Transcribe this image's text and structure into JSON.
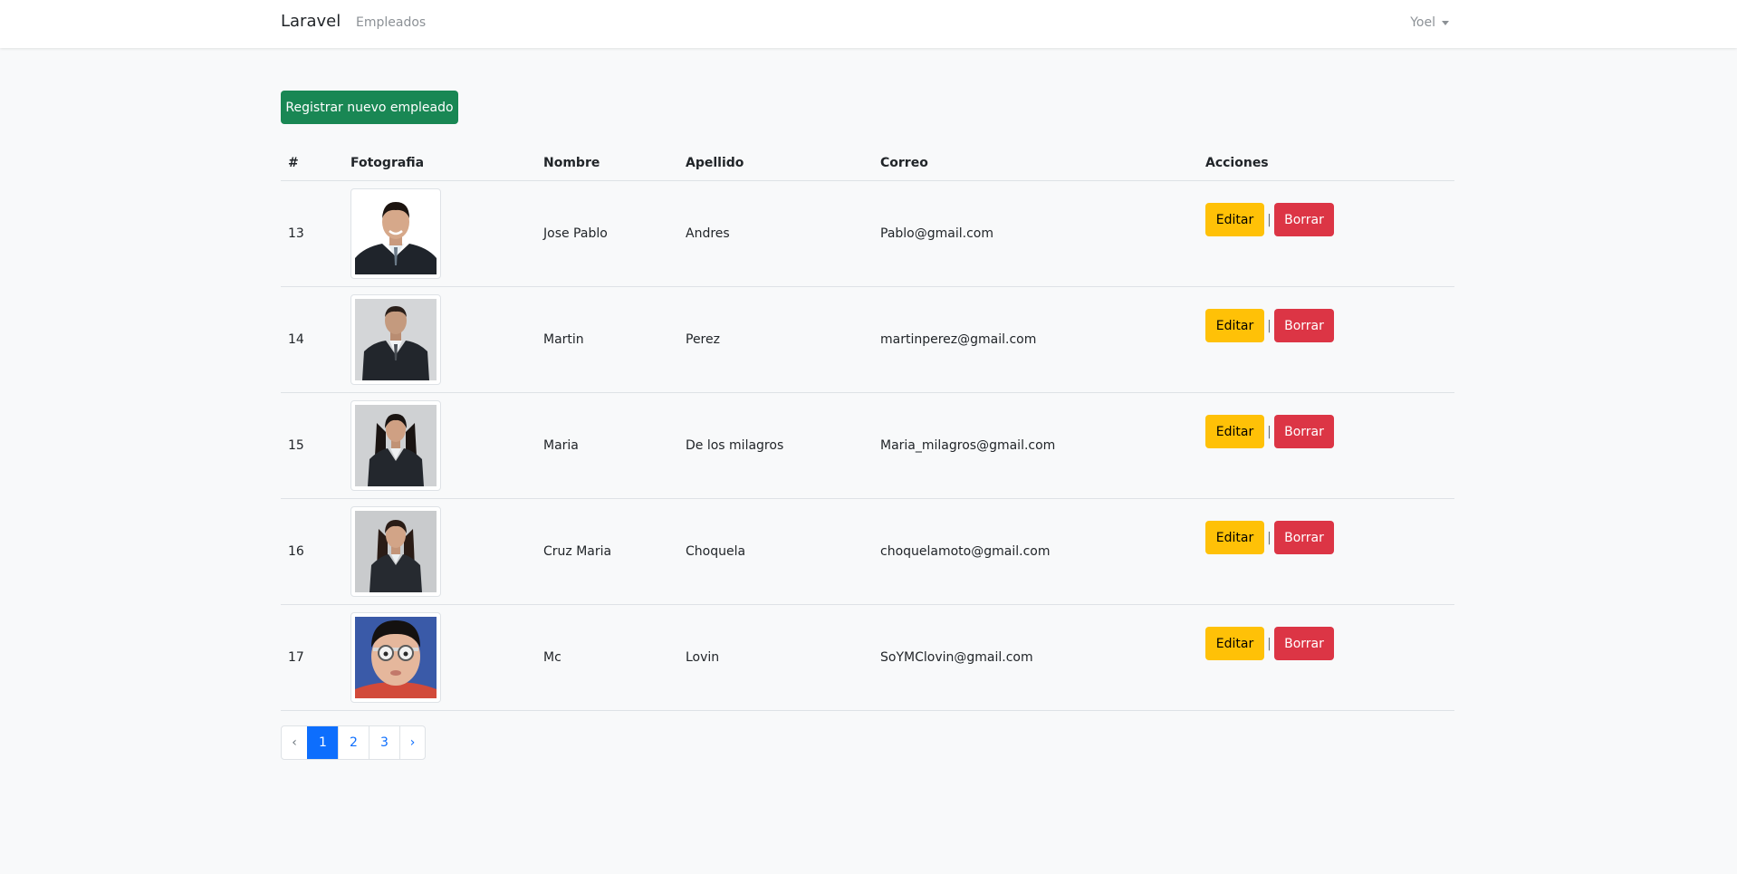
{
  "navbar": {
    "brand": "Laravel",
    "nav_link": "Empleados",
    "user": "Yoel"
  },
  "new_button_label": "Registrar nuevo empleado",
  "table": {
    "headers": {
      "id": "#",
      "photo": "Fotografia",
      "name": "Nombre",
      "last_name": "Apellido",
      "email": "Correo",
      "actions": "Acciones"
    },
    "rows": [
      {
        "id": "13",
        "name": "Jose Pablo",
        "last_name": "Andres",
        "email": "Pablo@gmail.com",
        "edit": "Editar",
        "sep": "|",
        "delete": "Borrar"
      },
      {
        "id": "14",
        "name": "Martin",
        "last_name": "Perez",
        "email": "martinperez@gmail.com",
        "edit": "Editar",
        "sep": "|",
        "delete": "Borrar"
      },
      {
        "id": "15",
        "name": "Maria",
        "last_name": "De los milagros",
        "email": "Maria_milagros@gmail.com",
        "edit": "Editar",
        "sep": "|",
        "delete": "Borrar"
      },
      {
        "id": "16",
        "name": "Cruz Maria",
        "last_name": "Choquela",
        "email": "choquelamoto@gmail.com",
        "edit": "Editar",
        "sep": "|",
        "delete": "Borrar"
      },
      {
        "id": "17",
        "name": "Mc",
        "last_name": "Lovin",
        "email": "SoYMClovin@gmail.com",
        "edit": "Editar",
        "sep": "|",
        "delete": "Borrar"
      }
    ]
  },
  "pagination": {
    "prev": "‹",
    "pages": [
      "1",
      "2",
      "3"
    ],
    "active_page": "1",
    "next": "›"
  },
  "colors": {
    "primary": "#0d6efd",
    "success": "#198754",
    "warning": "#ffc107",
    "danger": "#dc3545"
  }
}
